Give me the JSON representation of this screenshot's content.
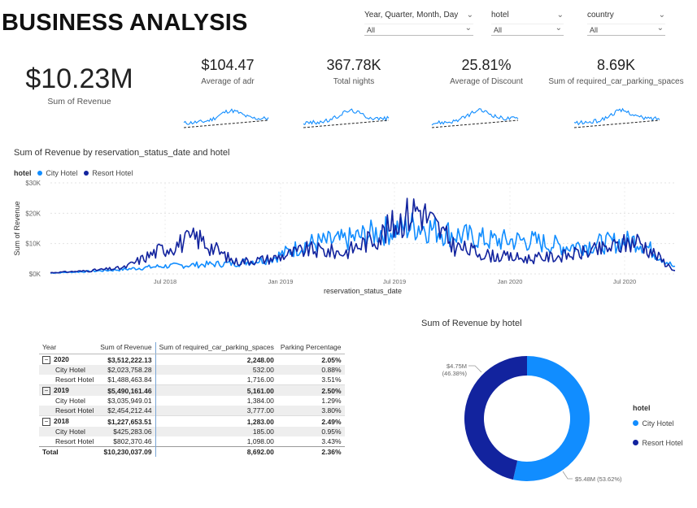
{
  "page": {
    "title": "BUSINESS ANALYSIS"
  },
  "slicers": [
    {
      "label": "Year, Quarter, Month, Day",
      "value": "All"
    },
    {
      "label": "hotel",
      "value": "All"
    },
    {
      "label": "country",
      "value": "All"
    }
  ],
  "kpis": {
    "revenue": {
      "value": "$10.23M",
      "label": "Sum of Revenue"
    },
    "cards": [
      {
        "value": "$104.47",
        "label": "Average of adr"
      },
      {
        "value": "367.78K",
        "label": "Total nights"
      },
      {
        "value": "25.81%",
        "label": "Average of Discount"
      },
      {
        "value": "8.69K",
        "label": "Sum of required_car_parking_spaces"
      }
    ]
  },
  "colors": {
    "city": "#118dff",
    "resort": "#12239e",
    "grid": "#e6e6e6"
  },
  "line_chart": {
    "title": "Sum of Revenue by reservation_status_date and hotel",
    "legend_title": "hotel",
    "xlabel": "reservation_status_date",
    "ylabel": "Sum of Revenue",
    "y_ticks": [
      "$30K",
      "$20K",
      "$10K",
      "$0K"
    ],
    "x_ticks": [
      "Jul 2018",
      "Jan 2019",
      "Jul 2019",
      "Jan 2020",
      "Jul 2020"
    ]
  },
  "chart_data": [
    {
      "type": "line",
      "title": "Sum of Revenue by reservation_status_date and hotel",
      "xlabel": "reservation_status_date",
      "ylabel": "Sum of Revenue",
      "ylim": [
        0,
        30000
      ],
      "x": [
        "2018-01",
        "2018-03",
        "2018-05",
        "2018-07",
        "2018-08",
        "2018-10",
        "2019-01",
        "2019-03",
        "2019-05",
        "2019-07",
        "2019-08",
        "2019-10",
        "2020-01",
        "2020-03",
        "2020-05",
        "2020-07",
        "2020-08",
        "2020-09"
      ],
      "series": [
        {
          "name": "City Hotel",
          "values": [
            300,
            800,
            1500,
            2500,
            3000,
            3500,
            5000,
            10000,
            11000,
            14000,
            16000,
            13000,
            11000,
            11000,
            9000,
            10000,
            11000,
            2000
          ]
        },
        {
          "name": "Resort Hotel",
          "values": [
            400,
            1000,
            2000,
            8000,
            12000,
            4000,
            5000,
            8000,
            7000,
            13000,
            22000,
            9000,
            6000,
            5000,
            6000,
            8000,
            11000,
            1000
          ]
        }
      ],
      "legend": "top-left",
      "grid": true
    },
    {
      "type": "pie",
      "title": "Sum of Revenue by hotel",
      "categories": [
        "City Hotel",
        "Resort Hotel"
      ],
      "values": [
        5.48,
        4.75
      ],
      "labels": [
        "$5.48M (53.62%)",
        "$4.75M (46.38%)"
      ],
      "legend_title": "hotel",
      "legend": "right"
    }
  ],
  "donut": {
    "title": "Sum of Revenue by hotel",
    "legend_title": "hotel",
    "city_label": "City Hotel",
    "resort_label": "Resort Hotel",
    "resort_value": "$4.75M",
    "resort_pct": "(46.38%)",
    "city_callout": "$5.48M (53.62%)"
  },
  "matrix": {
    "headers": [
      "Year",
      "Sum of Revenue",
      "Sum of required_car_parking_spaces",
      "Parking Percentage"
    ],
    "rows": [
      {
        "kind": "yr",
        "cells": [
          "2020",
          "$3,512,222.13",
          "2,248.00",
          "2.05%"
        ]
      },
      {
        "kind": "sub shade",
        "cells": [
          "City Hotel",
          "$2,023,758.28",
          "532.00",
          "0.88%"
        ]
      },
      {
        "kind": "sub",
        "cells": [
          "Resort Hotel",
          "$1,488,463.84",
          "1,716.00",
          "3.51%"
        ]
      },
      {
        "kind": "yr shade",
        "cells": [
          "2019",
          "$5,490,161.46",
          "5,161.00",
          "2.50%"
        ]
      },
      {
        "kind": "sub",
        "cells": [
          "City Hotel",
          "$3,035,949.01",
          "1,384.00",
          "1.29%"
        ]
      },
      {
        "kind": "sub shade",
        "cells": [
          "Resort Hotel",
          "$2,454,212.44",
          "3,777.00",
          "3.80%"
        ]
      },
      {
        "kind": "yr",
        "cells": [
          "2018",
          "$1,227,653.51",
          "1,283.00",
          "2.49%"
        ]
      },
      {
        "kind": "sub shade",
        "cells": [
          "City Hotel",
          "$425,283.06",
          "185.00",
          "0.95%"
        ]
      },
      {
        "kind": "sub",
        "cells": [
          "Resort Hotel",
          "$802,370.46",
          "1,098.00",
          "3.43%"
        ]
      },
      {
        "kind": "total",
        "cells": [
          "Total",
          "$10,230,037.09",
          "8,692.00",
          "2.36%"
        ]
      }
    ]
  }
}
